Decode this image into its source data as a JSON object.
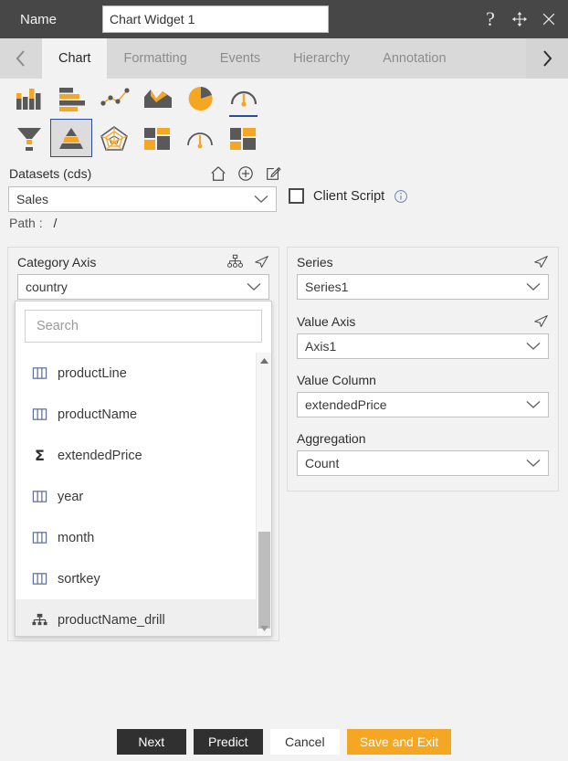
{
  "titlebar": {
    "name_label": "Name",
    "name_value": "Chart Widget 1",
    "help_glyph": "?",
    "icons": [
      "help-icon",
      "move-icon",
      "close-icon"
    ]
  },
  "tabs": {
    "prev_label": "‹",
    "next_label": "›",
    "items": [
      {
        "label": "Chart",
        "active": true
      },
      {
        "label": "Formatting",
        "active": false
      },
      {
        "label": "Events",
        "active": false
      },
      {
        "label": "Hierarchy",
        "active": false
      },
      {
        "label": "Annotation",
        "active": false
      }
    ]
  },
  "chart_types": {
    "row1": [
      {
        "name": "column-chart-icon",
        "selected": false
      },
      {
        "name": "bar-chart-icon",
        "selected": false
      },
      {
        "name": "line-scatter-chart-icon",
        "selected": false
      },
      {
        "name": "area-chart-icon",
        "selected": false
      },
      {
        "name": "pie-chart-icon",
        "selected": false
      },
      {
        "name": "gauge-chart-icon",
        "selected": true
      }
    ],
    "row2": [
      {
        "name": "funnel-chart-icon",
        "selected": false
      },
      {
        "name": "pyramid-chart-icon",
        "selected": true
      },
      {
        "name": "radar-chart-icon",
        "selected": false
      },
      {
        "name": "treemap-chart-icon",
        "selected": false
      },
      {
        "name": "dial-gauge-chart-icon",
        "selected": false
      },
      {
        "name": "tile-chart-icon",
        "selected": false
      }
    ]
  },
  "datasets": {
    "label": "Datasets (cds)",
    "icons": [
      "home-icon",
      "add-circle-icon",
      "edit-icon"
    ],
    "selected": "Sales",
    "path_label": "Path :",
    "path_value": "/",
    "client_script_label": "Client Script",
    "client_script_checked": false,
    "client_script_info": "i"
  },
  "category_axis": {
    "title": "Category Axis",
    "icons": [
      "hierarchy-icon",
      "send-icon"
    ],
    "selected": "country"
  },
  "dropdown": {
    "search_placeholder": "Search",
    "search_value": "",
    "items": [
      {
        "label": "productLine",
        "icon": "column-field-icon",
        "highlighted": false
      },
      {
        "label": "productName",
        "icon": "column-field-icon",
        "highlighted": false
      },
      {
        "label": "extendedPrice",
        "icon": "measure-sigma-icon",
        "highlighted": false
      },
      {
        "label": "year",
        "icon": "column-field-icon",
        "highlighted": false
      },
      {
        "label": "month",
        "icon": "column-field-icon",
        "highlighted": false
      },
      {
        "label": "sortkey",
        "icon": "column-field-icon",
        "highlighted": false
      },
      {
        "label": "productName_drill",
        "icon": "drill-hierarchy-icon",
        "highlighted": true
      }
    ]
  },
  "right_panel": {
    "series": {
      "label": "Series",
      "value": "Series1",
      "icon": "send-icon"
    },
    "value_axis": {
      "label": "Value Axis",
      "value": "Axis1",
      "icon": "send-icon"
    },
    "value_column": {
      "label": "Value Column",
      "value": "extendedPrice"
    },
    "aggregation": {
      "label": "Aggregation",
      "value": "Count"
    }
  },
  "footer": {
    "next": "Next",
    "predict": "Predict",
    "cancel": "Cancel",
    "save_and_exit": "Save and Exit"
  },
  "colors": {
    "accent_orange": "#f5a623",
    "dark_gray": "#474747",
    "selection_blue": "#2b4c9b",
    "panel_bg": "#f2f2f2"
  }
}
